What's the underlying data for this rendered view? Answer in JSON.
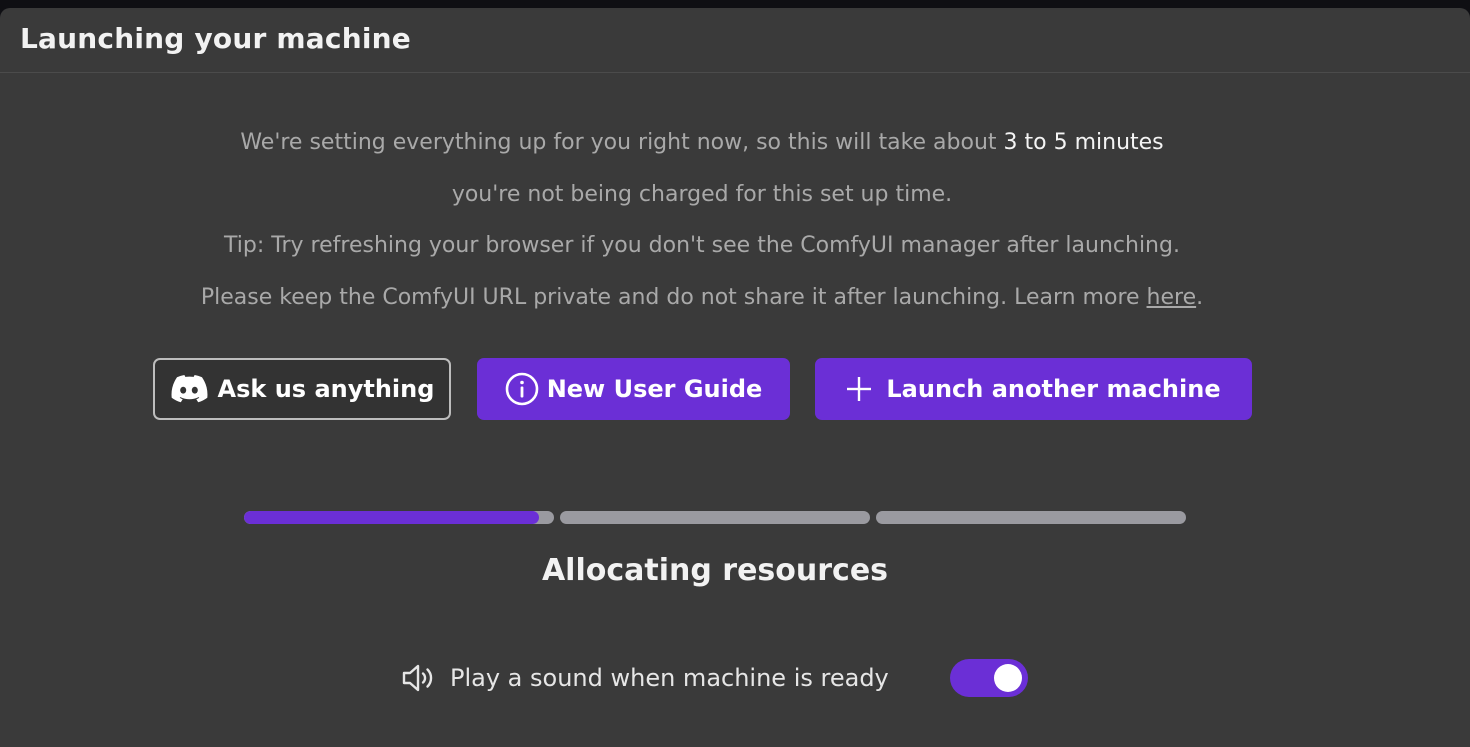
{
  "modal": {
    "title": "Launching your machine"
  },
  "info": {
    "line1_prefix": "We're setting everything up for you right now, so this will take about ",
    "line1_emphasis": "3 to 5 minutes",
    "line2": "you're not being charged for this set up time.",
    "line3": "Tip: Try refreshing your browser if you don't see the ComfyUI manager after launching.",
    "line4_prefix": "Please keep the ComfyUI URL private and do not share it after launching. Learn more ",
    "line4_link": "here",
    "line4_suffix": "."
  },
  "actions": {
    "discord_label": "Ask us anything",
    "guide_label": "New User Guide",
    "launch_label": "Launch another machine"
  },
  "progress": {
    "steps_total": 3,
    "segment_fill": [
      0.95,
      0,
      0
    ],
    "status_label": "Allocating resources"
  },
  "sound": {
    "label": "Play a sound when machine is ready",
    "enabled": true
  },
  "colors": {
    "accent": "#6b2fd6",
    "panel_bg": "#3a3a3a",
    "track": "#9a9aa0"
  }
}
